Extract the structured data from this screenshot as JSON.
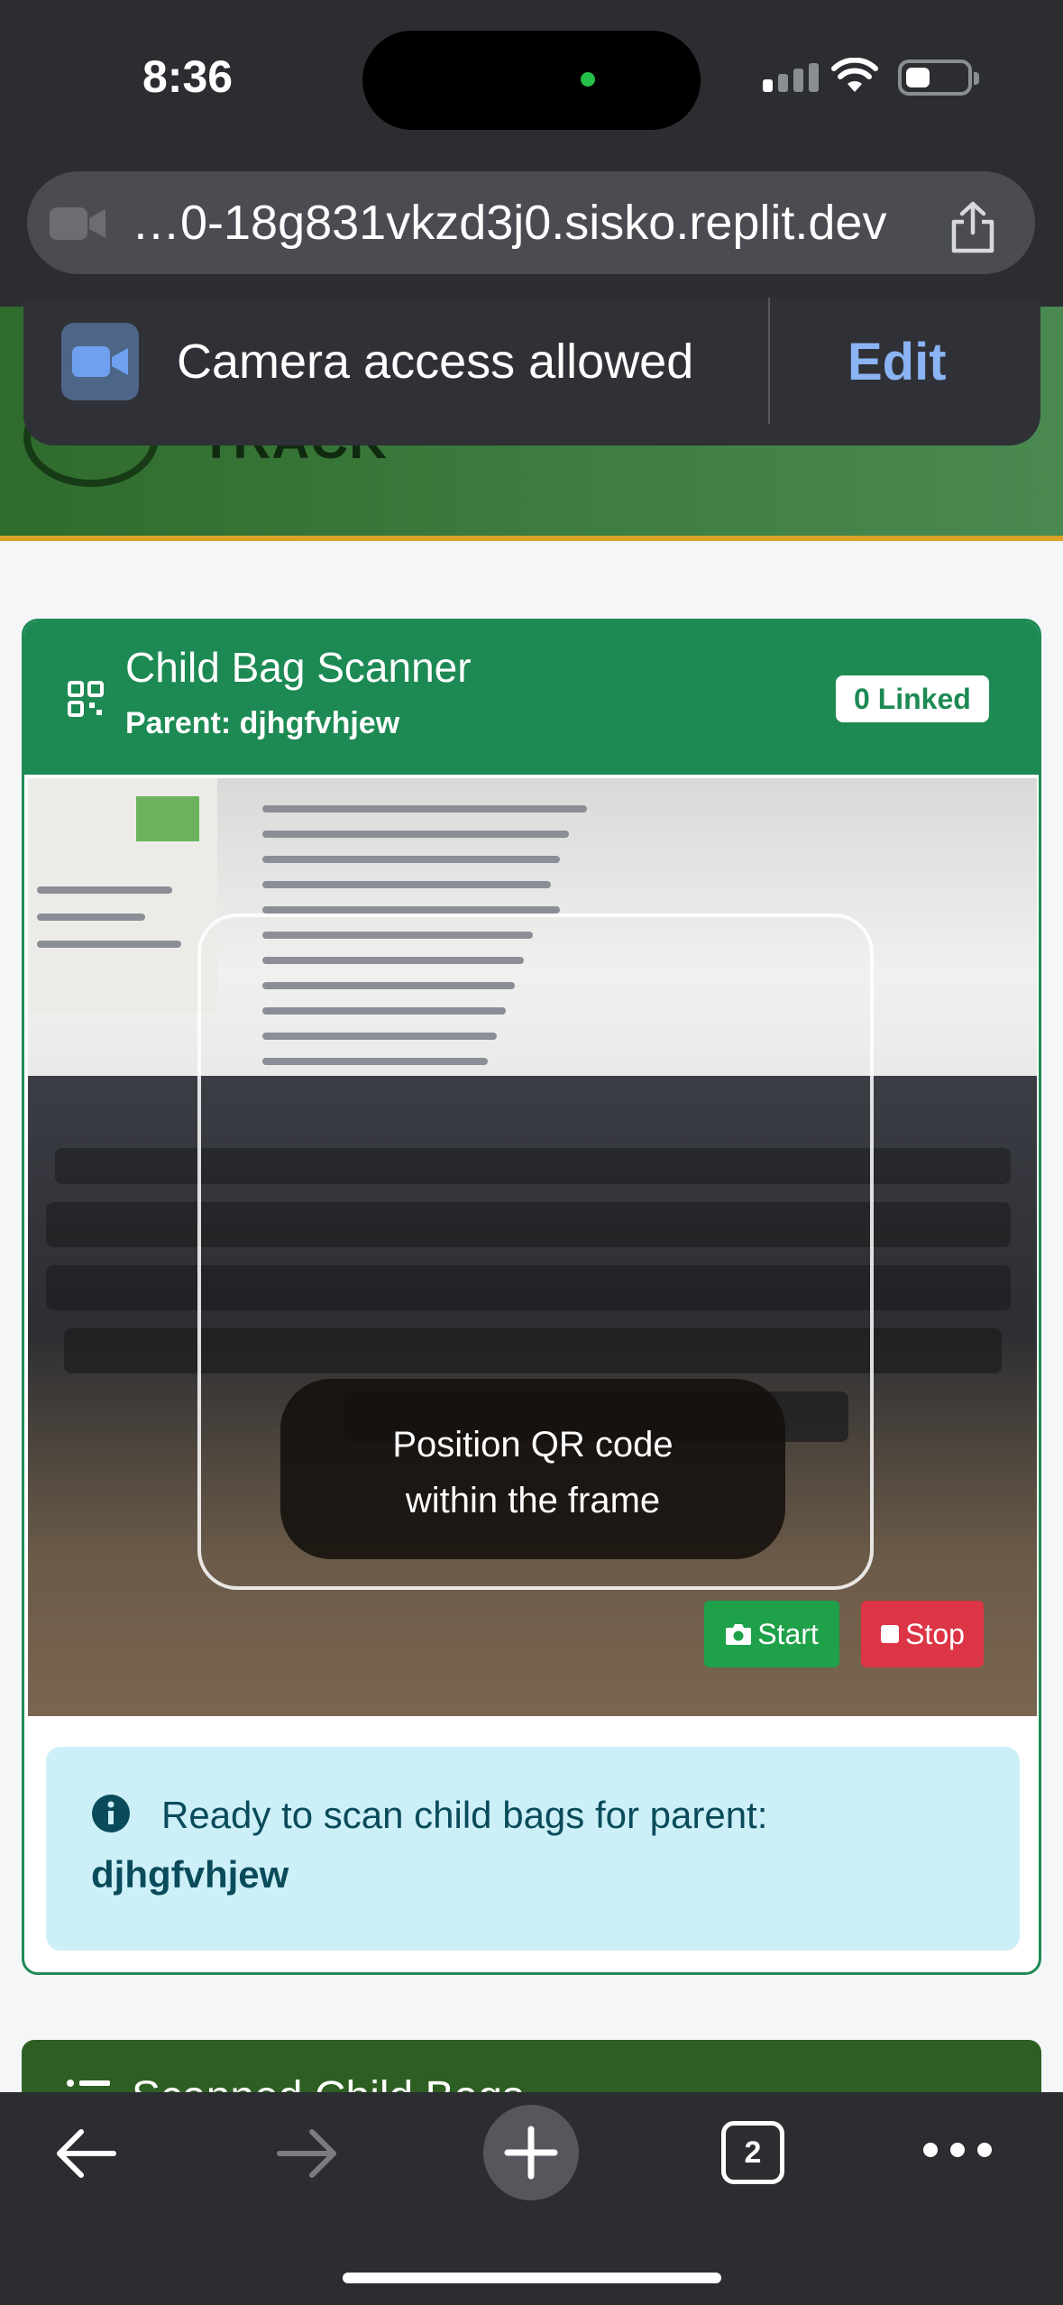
{
  "status_bar": {
    "time": "8:36"
  },
  "browser": {
    "url": "…0-18g831vkzd3j0.sisko.replit.dev",
    "camera_popup": {
      "text": "Camera access allowed",
      "edit_label": "Edit"
    },
    "tab_count": "2"
  },
  "app": {
    "logo_text": "TRACK"
  },
  "scanner": {
    "title": "Child Bag Scanner",
    "subtitle": "Parent: djhgfvhjew",
    "linked_badge": "0 Linked",
    "hint_line1": "Position QR code",
    "hint_line2": "within the frame",
    "start_label": "Start",
    "stop_label": "Stop",
    "info_text": "Ready to scan child bags for parent:",
    "info_parent": "djhgfvhjew"
  },
  "scanned_section": {
    "title": "Scanned Child Bags"
  },
  "colors": {
    "primary_green": "#1d8a54",
    "header_green": "#3f7f42",
    "stop_red": "#dc3545",
    "start_green": "#1fa14a",
    "info_bg": "#cdf0f8"
  }
}
